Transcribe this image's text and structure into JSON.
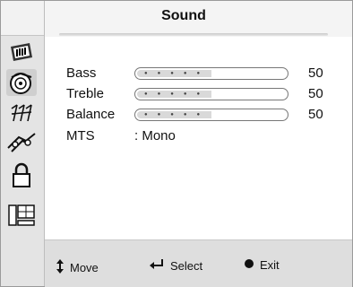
{
  "menu": {
    "title": "Sound",
    "items": [
      {
        "label": "Bass",
        "value": "50",
        "level": 0.5
      },
      {
        "label": "Treble",
        "value": "50",
        "level": 0.5
      },
      {
        "label": "Balance",
        "value": "50",
        "level": 0.5
      }
    ],
    "mts": {
      "label": "MTS",
      "value": ": Mono"
    }
  },
  "sidebar": {
    "icons": [
      "picture-icon",
      "sound-icon",
      "channel-icon",
      "setup-icon",
      "lock-icon",
      "pc-icon"
    ],
    "active": "sound-icon"
  },
  "footer": {
    "move_label": "Move",
    "select_label": "Select",
    "exit_label": "Exit"
  },
  "colors": {
    "panel": "#dcdcdc",
    "menu_bg": "#ffffff",
    "text": "#111111"
  }
}
